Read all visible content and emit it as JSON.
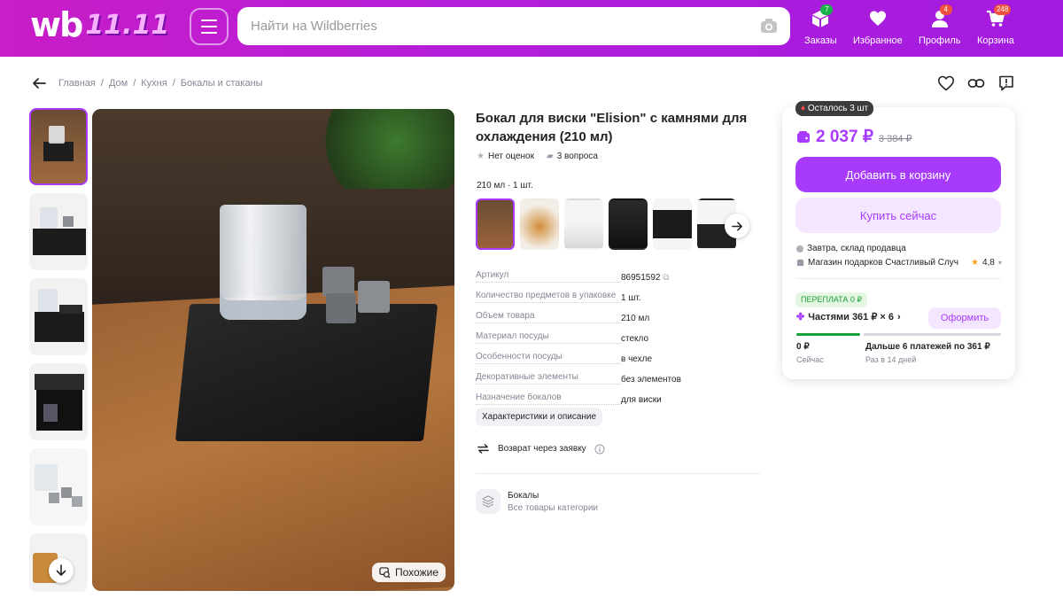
{
  "header": {
    "logo_text": "wb",
    "promo_text": "11.11",
    "search_placeholder": "Найти на Wildberries",
    "nav": [
      {
        "label": "Заказы",
        "badge": "7",
        "badge_color": "#19b34a"
      },
      {
        "label": "Избранное",
        "badge": "",
        "badge_color": ""
      },
      {
        "label": "Профиль",
        "badge": "4",
        "badge_color": "#f0503d"
      },
      {
        "label": "Корзина",
        "badge": "248",
        "badge_color": "#f0503d"
      }
    ]
  },
  "breadcrumbs": [
    "Главная",
    "Дом",
    "Кухня",
    "Бокалы и стаканы"
  ],
  "product": {
    "title": "Бокал для виски \"Elision\" с камнями для охлаждения (210 мл)",
    "rating_text": "Нет оценок",
    "questions_text": "3 вопроса",
    "variant": "210 мл · 1 шт.",
    "similar_label": "Похожие",
    "specs": [
      {
        "k": "Артикул",
        "v": "86951592"
      },
      {
        "k": "Количество предметов в упаковке",
        "v": "1 шт."
      },
      {
        "k": "Объем товара",
        "v": "210 мл"
      },
      {
        "k": "Материал посуды",
        "v": "стекло"
      },
      {
        "k": "Особенности посуды",
        "v": "в чехле"
      },
      {
        "k": "Декоративные элементы",
        "v": "без элементов"
      },
      {
        "k": "Назначение бокалов",
        "v": "для виски"
      }
    ],
    "specs_button": "Характеристики и описание",
    "return_text": "Возврат через заявку",
    "category_title": "Бокалы",
    "category_sub": "Все товары категории"
  },
  "buy": {
    "stock_badge": "Осталось 3 шт",
    "price": "2 037 ₽",
    "old_price": "3 384 ₽",
    "add_to_cart": "Добавить в корзину",
    "buy_now": "Купить сейчас",
    "delivery": "Завтра, склад продавца",
    "seller": "Магазин подарков Счастливый Случ",
    "seller_rating": "4,8",
    "overpay": "ПЕРЕПЛАТА 0 ₽",
    "installments": "Частями 361 ₽ × 6",
    "apply_button": "Оформить",
    "pay_now": "0 ₽",
    "pay_now_sub": "Сейчас",
    "pay_later": "Дальше 6 платежей по 361 ₽",
    "pay_later_sub": "Раз в 14 дней"
  },
  "colors": {
    "accent": "#a73afd",
    "header": "#b31ed9",
    "green": "#14a13b"
  }
}
